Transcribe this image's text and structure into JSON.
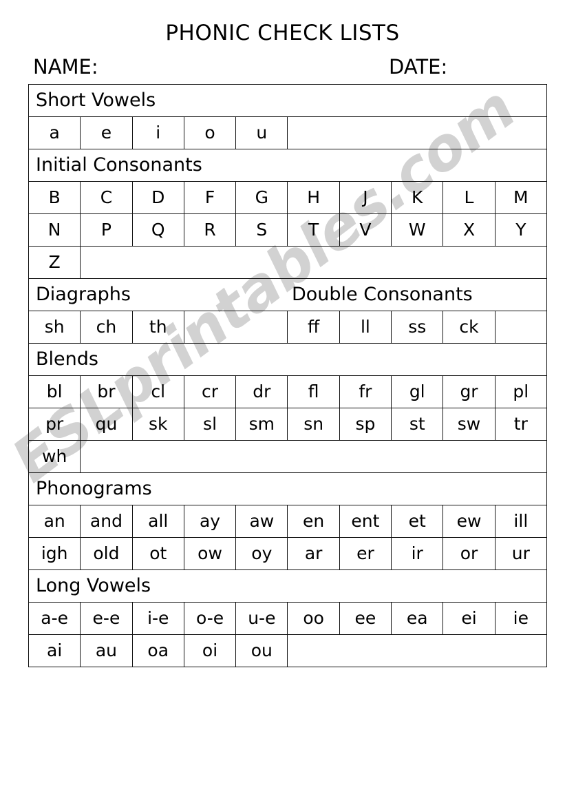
{
  "document": {
    "title": "PHONIC CHECK LISTS",
    "name_label": "NAME:",
    "date_label": "DATE:"
  },
  "watermark": {
    "text": "ESLprintables.com",
    "color": "#d2d2d2"
  },
  "colors": {
    "text": "#000000",
    "border": "#111111",
    "background": "#ffffff"
  },
  "sections": [
    {
      "heading": "Short Vowels",
      "rows": [
        [
          "a",
          "e",
          "i",
          "o",
          "u"
        ]
      ]
    },
    {
      "heading": "Initial Consonants",
      "rows": [
        [
          "B",
          "C",
          "D",
          "F",
          "G",
          "H",
          "J",
          "K",
          "L",
          "M"
        ],
        [
          "N",
          "P",
          "Q",
          "R",
          "S",
          "T",
          "V",
          "W",
          "X",
          "Y"
        ],
        [
          "Z"
        ]
      ]
    },
    {
      "heading": "Diagraphs",
      "heading_right": "Double Consonants",
      "rows_left": [
        [
          "sh",
          "ch",
          "th"
        ]
      ],
      "rows_right": [
        [
          "ff",
          "ll",
          "ss",
          "ck"
        ]
      ]
    },
    {
      "heading": "Blends",
      "rows": [
        [
          "bl",
          "br",
          "cl",
          "cr",
          "dr",
          "fl",
          "fr",
          "gl",
          "gr",
          "pl"
        ],
        [
          "pr",
          "qu",
          "sk",
          "sl",
          "sm",
          "sn",
          "sp",
          "st",
          "sw",
          "tr"
        ],
        [
          "wh"
        ]
      ]
    },
    {
      "heading": "Phonograms",
      "rows": [
        [
          "an",
          "and",
          "all",
          "ay",
          "aw",
          "en",
          "ent",
          "et",
          "ew",
          "ill"
        ],
        [
          "igh",
          "old",
          "ot",
          "ow",
          "oy",
          "ar",
          "er",
          "ir",
          "or",
          "ur"
        ]
      ]
    },
    {
      "heading": "Long Vowels",
      "rows": [
        [
          "a-e",
          "e-e",
          "i-e",
          "o-e",
          "u-e",
          "oo",
          "ee",
          "ea",
          "ei",
          "ie"
        ],
        [
          "ai",
          "au",
          "oa",
          "oi",
          "ou"
        ]
      ]
    }
  ]
}
